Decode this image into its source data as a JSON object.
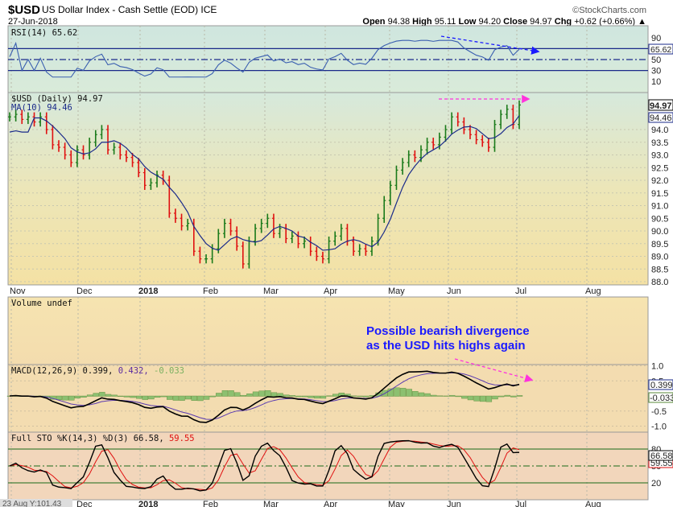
{
  "header": {
    "symbol": "$USD",
    "name": "US Dollar Index - Cash Settle (EOD) ICE",
    "date": "27-Jun-2018",
    "watermark": "©StockCharts.com",
    "open_label": "Open",
    "open": "94.38",
    "high_label": "High",
    "high": "95.11",
    "low_label": "Low",
    "low": "94.20",
    "close_label": "Close",
    "close": "94.97",
    "chg_label": "Chg",
    "chg": "+0.62 (+0.66%)"
  },
  "colors": {
    "up": "#1a7a1a",
    "down": "#e01010",
    "ma": "#1a2a8a",
    "rsi": "#3a5fb0",
    "annotation": "#1a1aff",
    "arrow_pink": "#ff33dd"
  },
  "annotation": {
    "line1": "Possible bearish divergence",
    "line2": "as the USD hits highs again"
  },
  "crosshair_readout": "23 Aug Y:101.43",
  "chart_data": [
    {
      "type": "line",
      "panel": "rsi",
      "title": "RSI(14) 65.62",
      "last_value": "65.62",
      "yticks": [
        "90",
        "70",
        "50",
        "30",
        "10"
      ],
      "reference_lines": [
        70,
        50,
        30
      ],
      "ylim": [
        0,
        100
      ]
    },
    {
      "type": "ohlc",
      "panel": "price",
      "title": "$USD (Daily) 94.97",
      "ma_label": "MA(10) 94.46",
      "last_close_tag": "94.97",
      "ma_tag": "94.46",
      "yticks": [
        "94.0",
        "93.5",
        "93.0",
        "92.5",
        "92.0",
        "91.5",
        "91.0",
        "90.5",
        "90.0",
        "89.5",
        "89.0",
        "88.5",
        "88.0"
      ],
      "ylim": [
        88.0,
        95.3
      ],
      "xticks": [
        "Nov",
        "Dec",
        "2018",
        "Feb",
        "Mar",
        "Apr",
        "May",
        "Jun",
        "Jul",
        "Aug"
      ],
      "closes": [
        94.5,
        94.6,
        94.4,
        94.5,
        94.3,
        94.5,
        94.0,
        93.4,
        93.3,
        93.0,
        92.7,
        93.2,
        93.0,
        93.5,
        93.8,
        94.0,
        93.2,
        93.3,
        93.0,
        92.9,
        92.7,
        92.3,
        91.8,
        91.9,
        92.2,
        92.0,
        90.7,
        90.5,
        90.2,
        90.3,
        89.2,
        88.9,
        88.9,
        89.3,
        89.9,
        90.3,
        90.0,
        89.4,
        88.7,
        89.6,
        90.1,
        90.3,
        90.5,
        89.9,
        90.1,
        89.7,
        89.8,
        89.5,
        89.6,
        89.2,
        89.0,
        88.9,
        89.6,
        89.8,
        90.1,
        89.6,
        89.2,
        89.3,
        89.2,
        89.6,
        90.5,
        91.2,
        91.8,
        92.4,
        92.7,
        93.0,
        92.9,
        93.2,
        93.5,
        93.4,
        93.7,
        94.0,
        94.5,
        94.3,
        94.0,
        93.8,
        93.6,
        93.5,
        93.3,
        94.2,
        94.6,
        94.8,
        94.2,
        94.97
      ]
    },
    {
      "type": "bar",
      "panel": "volume",
      "title": "Volume undef"
    },
    {
      "type": "line",
      "panel": "macd",
      "title_main": "MACD(12,26,9) 0.399,",
      "signal_value": "0.432,",
      "hist_value": "-0.033",
      "tags": [
        "0.399",
        "-0.033"
      ],
      "yticks": [
        "1.0",
        "0.5",
        "-0.5",
        "-1.0"
      ],
      "ylim": [
        -1.2,
        1.1
      ]
    },
    {
      "type": "line",
      "panel": "stochastic",
      "title_main": "Full STO %K(14,3) %D(3) 66.58,",
      "d_value": "59.55",
      "tags": [
        "66.58",
        "59.55"
      ],
      "yticks": [
        "80",
        "50",
        "20"
      ],
      "reference_lines": [
        80,
        50,
        20
      ],
      "ylim": [
        0,
        100
      ],
      "xticks": [
        "Dec",
        "2018",
        "Feb",
        "Mar",
        "Apr",
        "May",
        "Jun",
        "Jul",
        "Aug"
      ]
    }
  ]
}
